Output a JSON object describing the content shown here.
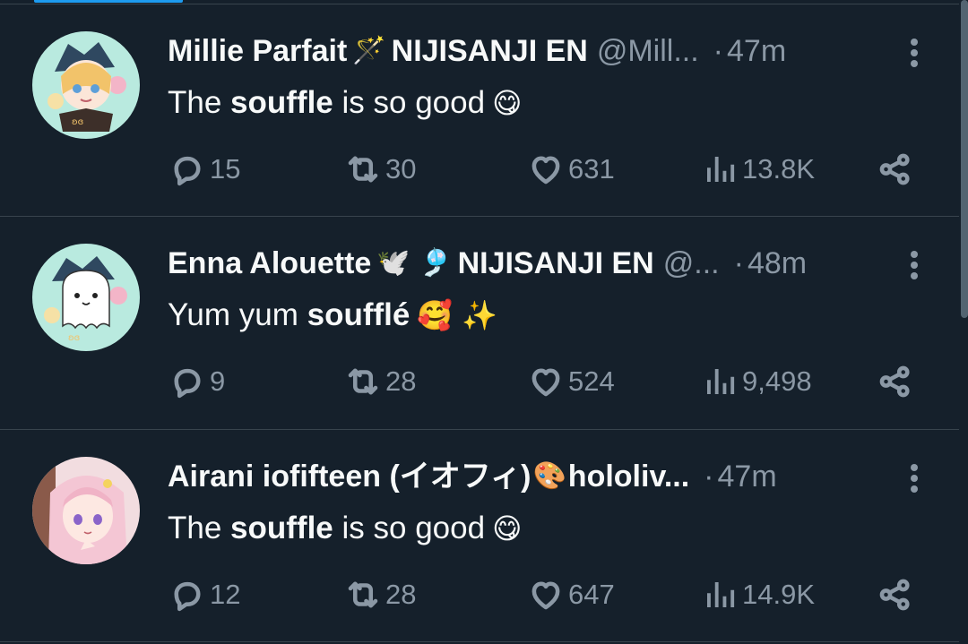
{
  "colors": {
    "background": "#15202b",
    "text": "#f7f9f9",
    "muted": "#8b98a5",
    "divider": "#38444d",
    "accent": "#1d9bf0"
  },
  "tweets": [
    {
      "name": "Millie Parfait",
      "name_emoji": "🪄",
      "affiliation": "NIJISANJI EN",
      "handle": "@Mill...",
      "dot": "·",
      "time": "47m",
      "text_before": "The ",
      "text_bold": "souffle",
      "text_after": " is so good",
      "text_emoji": "😋",
      "stats": {
        "replies": "15",
        "retweets": "30",
        "likes": "631",
        "views": "13.8K"
      },
      "avatar": "chibi-millie-avatar"
    },
    {
      "name": "Enna Alouette",
      "name_emoji": "🕊️ 🎐",
      "affiliation": "NIJISANJI EN",
      "handle": "@...",
      "dot": "·",
      "time": "48m",
      "text_before": "Yum yum ",
      "text_bold": "soufflé",
      "text_after": "",
      "text_emoji": "🥰 ✨",
      "stats": {
        "replies": "9",
        "retweets": "28",
        "likes": "524",
        "views": "9,498"
      },
      "avatar": "white-ghost-avatar"
    },
    {
      "name": "Airani iofifteen (イオフィ)",
      "name_emoji": "🎨",
      "affiliation": "hololiv...",
      "handle": "",
      "dot": "·",
      "time": "47m",
      "text_before": "The ",
      "text_bold": "souffle",
      "text_after": " is so good",
      "text_emoji": "😋",
      "stats": {
        "replies": "12",
        "retweets": "28",
        "likes": "647",
        "views": "14.9K"
      },
      "avatar": "pink-hair-girl-avatar"
    }
  ],
  "icons": {
    "reply": "reply-icon",
    "retweet": "retweet-icon",
    "like": "heart-icon",
    "views": "views-icon",
    "share": "share-icon",
    "more": "more-icon"
  }
}
